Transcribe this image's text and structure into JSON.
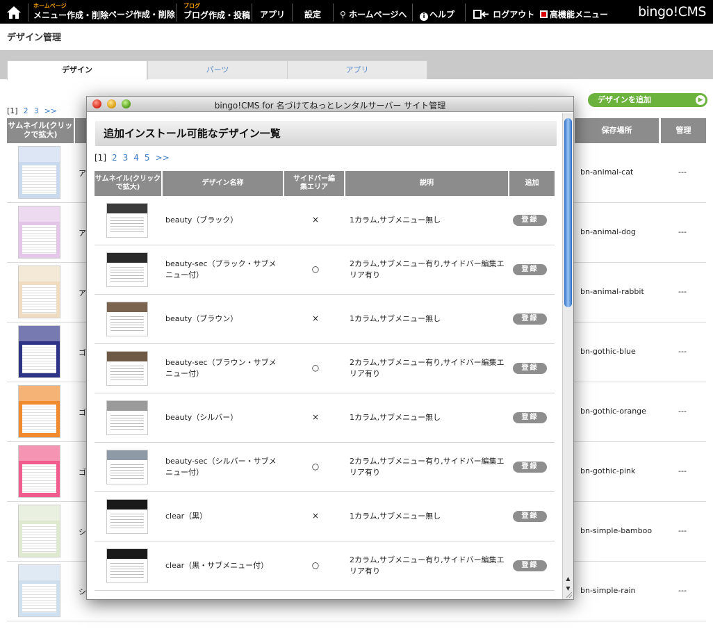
{
  "nav": {
    "menu_sup": "ホームページ",
    "menu_label": "メニュー作成・削除",
    "page_label": "ページ作成・削除",
    "blog_sup": "ブログ",
    "blog_label": "ブログ作成・投稿",
    "app_label": "アプリ",
    "settings_label": "設定",
    "homepage_label": "ホームページへ",
    "help_label": "ヘルプ",
    "logout_label": "ログアウト",
    "advanced_label": "高機能メニュー",
    "brand": "bingo!CMS"
  },
  "page": {
    "title": "デザイン管理",
    "tabs": [
      "デザイン",
      "パーツ",
      "アプリ"
    ],
    "pager": [
      "[1]",
      "2",
      "3",
      ">>"
    ],
    "add_design_label": "デザインを追加",
    "headers": {
      "thumb": "サムネイル(クリックで拡大)",
      "location": "保存場所",
      "manage": "管理"
    },
    "rows": [
      {
        "name": "ア",
        "location": "bn-animal-cat",
        "manage": "---",
        "color": "#c9d9ee"
      },
      {
        "name": "ア",
        "location": "bn-animal-dog",
        "manage": "---",
        "color": "#e3c6e8"
      },
      {
        "name": "ア",
        "location": "bn-animal-rabbit",
        "manage": "---",
        "color": "#efdcc1"
      },
      {
        "name": "ゴ",
        "location": "bn-gothic-blue",
        "manage": "---",
        "color": "#2e3388"
      },
      {
        "name": "ゴ",
        "location": "bn-gothic-orange",
        "manage": "---",
        "color": "#f08a2c"
      },
      {
        "name": "ゴ",
        "location": "bn-gothic-pink",
        "manage": "---",
        "color": "#f25b8d"
      },
      {
        "name": "シ",
        "location": "bn-simple-bamboo",
        "manage": "---",
        "color": "#dfe9cf"
      },
      {
        "name": "シ",
        "location": "bn-simple-rain",
        "manage": "---",
        "color": "#cfdfee"
      }
    ]
  },
  "modal": {
    "title": "bingo!CMS for 名づけてねっとレンタルサーバー サイト管理",
    "heading": "追加インストール可能なデザイン一覧",
    "pager": [
      "[1]",
      "2",
      "3",
      "4",
      "5",
      ">>"
    ],
    "headers": {
      "thumb": "サムネイル(クリックで拡大)",
      "name": "デザイン名称",
      "sidebar": "サイドバー編集エリア",
      "desc": "説明",
      "add": "追加"
    },
    "register_label": "登録",
    "rows": [
      {
        "name": "beauty（ブラック）",
        "sidebar": "×",
        "desc": "1カラム,サブメニュー無し",
        "tone": "#3a3a3a"
      },
      {
        "name": "beauty-sec（ブラック・サブメニュー付）",
        "sidebar": "○",
        "desc": "2カラム,サブメニュー有り,サイドバー編集エリア有り",
        "tone": "#2a2a2a"
      },
      {
        "name": "beauty（ブラウン）",
        "sidebar": "×",
        "desc": "1カラム,サブメニュー無し",
        "tone": "#7a6450"
      },
      {
        "name": "beauty-sec（ブラウン・サブメニュー付）",
        "sidebar": "○",
        "desc": "2カラム,サブメニュー有り,サイドバー編集エリア有り",
        "tone": "#6e5846"
      },
      {
        "name": "beauty（シルバー）",
        "sidebar": "×",
        "desc": "1カラム,サブメニュー無し",
        "tone": "#9a9a9a"
      },
      {
        "name": "beauty-sec（シルバー・サブメニュー付）",
        "sidebar": "○",
        "desc": "2カラム,サブメニュー有り,サイドバー編集エリア有り",
        "tone": "#8e9aa6"
      },
      {
        "name": "clear（黒）",
        "sidebar": "×",
        "desc": "1カラム,サブメニュー無し",
        "tone": "#1a1a1a"
      },
      {
        "name": "clear（黒・サブメニュー付）",
        "sidebar": "○",
        "desc": "2カラム,サブメニュー有り,サイドバー編集エリア有り",
        "tone": "#1a1a1a"
      }
    ]
  }
}
